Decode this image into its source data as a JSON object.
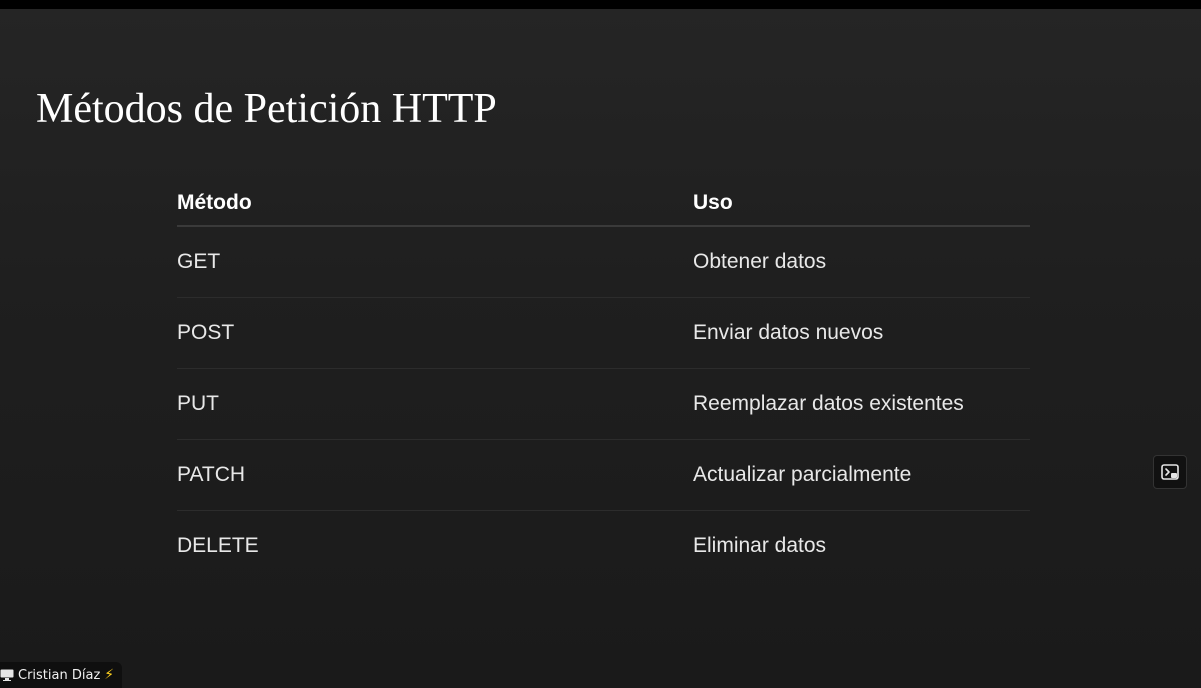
{
  "slide": {
    "title": "Métodos de Petición HTTP"
  },
  "table": {
    "headers": [
      "Método",
      "Uso"
    ],
    "rows": [
      [
        "GET",
        "Obtener datos"
      ],
      [
        "POST",
        "Enviar datos nuevos"
      ],
      [
        "PUT",
        "Reemplazar datos existentes"
      ],
      [
        "PATCH",
        "Actualizar parcialmente"
      ],
      [
        "DELETE",
        "Eliminar datos"
      ]
    ]
  },
  "pip_button": {
    "icon": "picture-in-picture-icon"
  },
  "author_badge": {
    "icon": "monitor-icon",
    "name": "Cristian Díaz",
    "emoji": "⚡",
    "emoji_icon": "lightning-bolt-icon"
  },
  "colors": {
    "background": "#1c1c1c",
    "text": "#ffffff",
    "accent": "#ffd21f"
  }
}
